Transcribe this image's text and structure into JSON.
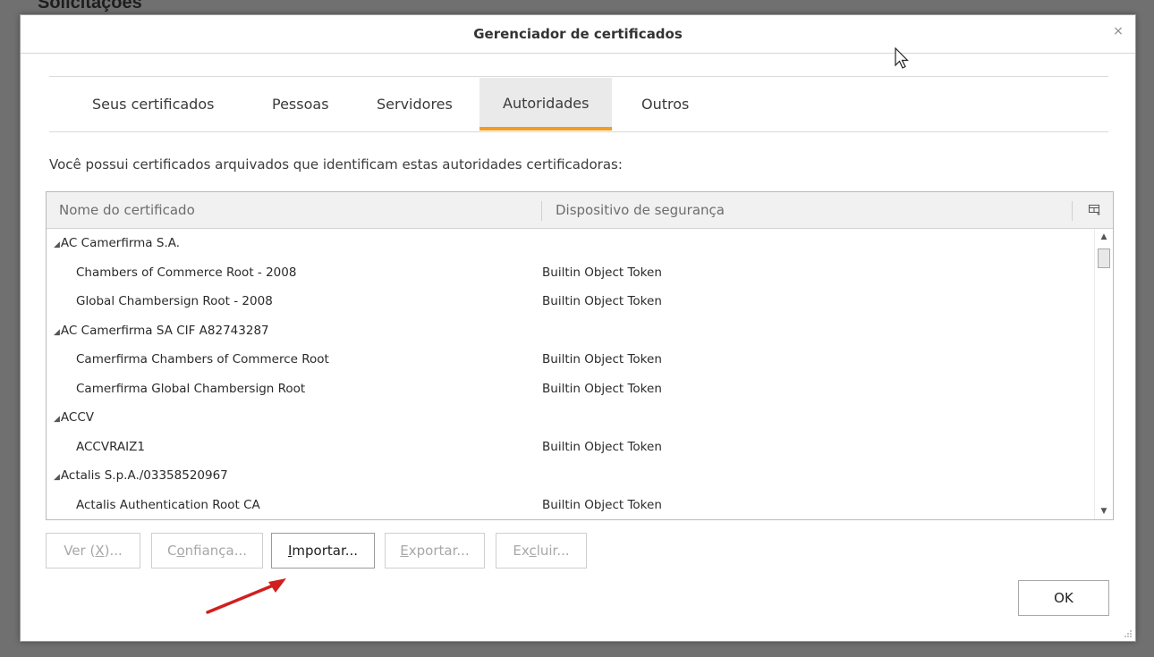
{
  "background": {
    "heading": "Solicitações"
  },
  "dialog": {
    "title": "Gerenciador de certificados",
    "close_glyph": "×"
  },
  "tabs": [
    {
      "label": "Seus certificados",
      "active": false
    },
    {
      "label": "Pessoas",
      "active": false
    },
    {
      "label": "Servidores",
      "active": false
    },
    {
      "label": "Autoridades",
      "active": true
    },
    {
      "label": "Outros",
      "active": false
    }
  ],
  "description": "Você possui certificados arquivados que identificam estas autoridades certificadoras:",
  "tree": {
    "columns": [
      "Nome do certificado",
      "Dispositivo de segurança"
    ],
    "rows": [
      {
        "type": "group",
        "name": "AC Camerfirma S.A.",
        "device": ""
      },
      {
        "type": "child",
        "name": "Chambers of Commerce Root - 2008",
        "device": "Builtin Object Token"
      },
      {
        "type": "child",
        "name": "Global Chambersign Root - 2008",
        "device": "Builtin Object Token"
      },
      {
        "type": "group",
        "name": "AC Camerfirma SA CIF A82743287",
        "device": ""
      },
      {
        "type": "child",
        "name": "Camerfirma Chambers of Commerce Root",
        "device": "Builtin Object Token"
      },
      {
        "type": "child",
        "name": "Camerfirma Global Chambersign Root",
        "device": "Builtin Object Token"
      },
      {
        "type": "group",
        "name": "ACCV",
        "device": ""
      },
      {
        "type": "child",
        "name": "ACCVRAIZ1",
        "device": "Builtin Object Token"
      },
      {
        "type": "group",
        "name": "Actalis S.p.A./03358520967",
        "device": ""
      },
      {
        "type": "child",
        "name": "Actalis Authentication Root CA",
        "device": "Builtin Object Token"
      }
    ],
    "twisty_glyph": "◢"
  },
  "buttons": {
    "view": {
      "pre": "Ver (",
      "key": "X",
      "post": ")..."
    },
    "trust": {
      "pre": "C",
      "key": "o",
      "post": "nfiança..."
    },
    "import": {
      "pre": "",
      "key": "I",
      "post": "mportar..."
    },
    "export": {
      "pre": "",
      "key": "E",
      "post": "xportar..."
    },
    "delete": {
      "pre": "Ex",
      "key": "c",
      "post": "luir..."
    },
    "ok": "OK"
  },
  "colors": {
    "accent_tab_underline": "#f29d1e",
    "annotation_arrow": "#d11f1f"
  }
}
